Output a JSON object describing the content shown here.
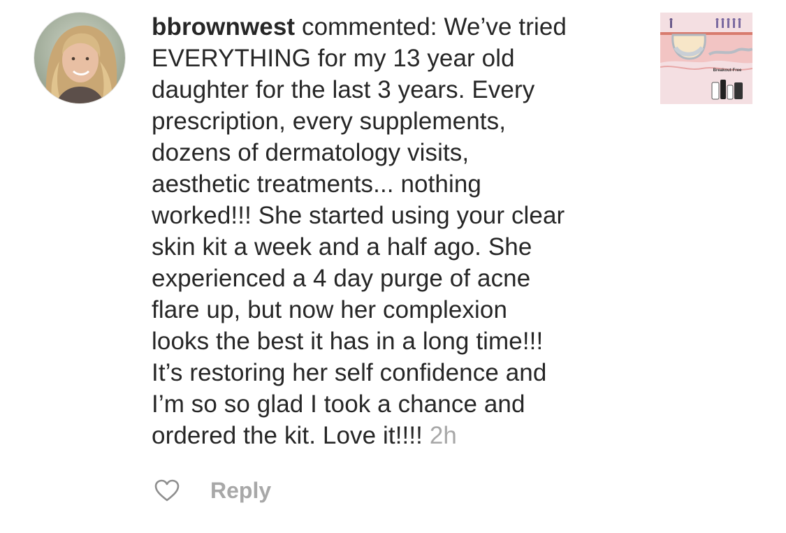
{
  "comment": {
    "username": "bbrownwest",
    "verb": "commented:",
    "lines": [
      "We’ve tried",
      "EVERYTHING for my 13 year old",
      "daughter for the last 3 years.  Every",
      "prescription, every supplements,",
      "dozens of dermatology visits,",
      "aesthetic treatments... nothing",
      "worked!!! She started using your clear",
      "skin kit a week and a half ago.  She",
      "experienced a 4 day purge of acne",
      "flare up, but now her complexion",
      "looks the best it has in a long time!!!",
      "It’s restoring her self confidence and",
      "I’m so so glad I took a chance and",
      "ordered the kit.  Love it!!!!"
    ],
    "time": "2h"
  },
  "actions": {
    "reply_label": "Reply"
  },
  "post_thumbnail": {
    "brand_text": "Breakout-Free"
  },
  "icons": {
    "like": "heart-outline-icon"
  },
  "colors": {
    "text": "#262626",
    "muted": "#a8a8a8",
    "thumbnail_bg": "#f4dfe2"
  }
}
